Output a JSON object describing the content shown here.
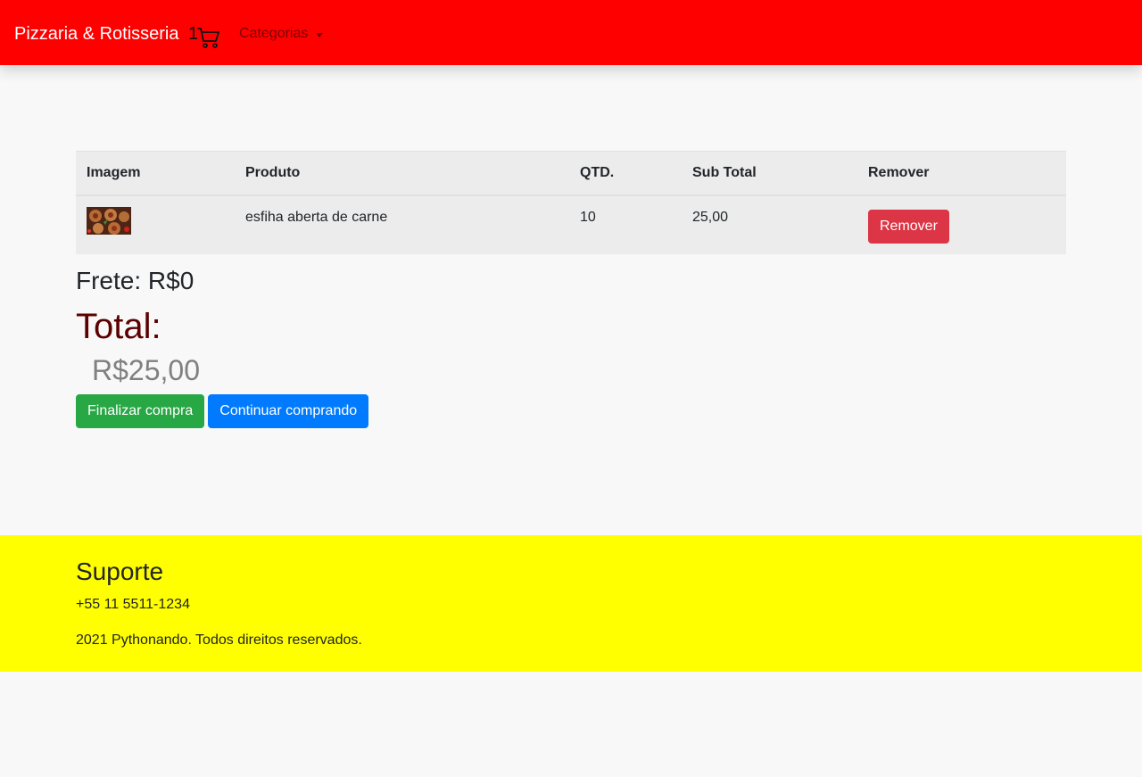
{
  "navbar": {
    "brand": "Pizzaria & Rotisseria",
    "cart_count": "1",
    "cart_icon": "shopping-cart-icon",
    "categories_label": "Categorias",
    "background": "#ff0000"
  },
  "cart": {
    "columns": [
      "Imagem",
      "Produto",
      "QTD.",
      "Sub Total",
      "Remover"
    ],
    "rows": [
      {
        "image": "esfiha-image",
        "product": "esfiha aberta de carne",
        "quantity": "10",
        "subtotal": "25,00",
        "remove_label": "Remover"
      }
    ]
  },
  "summary": {
    "shipping": "Frete: R$0",
    "total_label": "Total:",
    "total_value": "R$25,00"
  },
  "actions": {
    "checkout": "Finalizar compra",
    "continue": "Continuar comprando"
  },
  "footer": {
    "title": "Suporte",
    "phone": "+55 11 5511-1234",
    "copyright": "2021 Pythonando. Todos direitos reservados.",
    "background": "#ffff00"
  }
}
